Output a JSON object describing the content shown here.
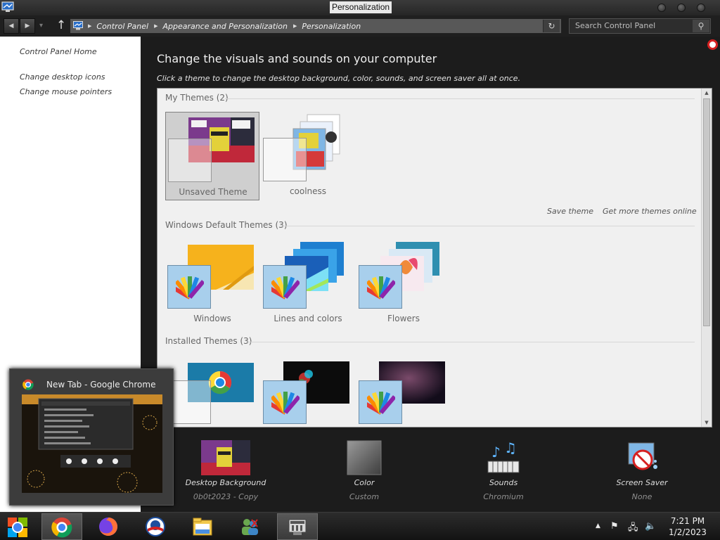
{
  "window": {
    "title": "Personalization"
  },
  "navigation": {
    "breadcrumb": [
      "Control Panel",
      "Appearance and Personalization",
      "Personalization"
    ],
    "search_placeholder": "Search Control Panel"
  },
  "sidebar": {
    "home_link": "Control Panel Home",
    "links": [
      "Change desktop icons",
      "Change mouse pointers"
    ]
  },
  "main": {
    "title": "Change the visuals and sounds on your computer",
    "subtitle": "Click a theme to change the desktop background, color, sounds, and screen saver all at once.",
    "sections": {
      "my_themes": "My Themes (2)",
      "windows_default": "Windows Default Themes (3)",
      "installed": "Installed Themes (3)"
    },
    "my_themes": [
      {
        "label": "Unsaved Theme",
        "selected": true
      },
      {
        "label": "coolness",
        "selected": false
      }
    ],
    "default_themes": [
      {
        "label": "Windows"
      },
      {
        "label": "Lines and colors"
      },
      {
        "label": "Flowers"
      }
    ],
    "save_theme_link": "Save theme",
    "get_more_link": "Get more themes online"
  },
  "bottom_bar": {
    "items": [
      {
        "label": "Desktop Background",
        "value": "0b0t2023 - Copy",
        "icon": "desktop-background-icon"
      },
      {
        "label": "Color",
        "value": "Custom",
        "icon": "color-icon"
      },
      {
        "label": "Sounds",
        "value": "Chromium",
        "icon": "sounds-icon"
      },
      {
        "label": "Screen Saver",
        "value": "None",
        "icon": "screen-saver-icon"
      }
    ]
  },
  "taskbar_preview": {
    "title": "New Tab - Google Chrome"
  },
  "taskbar": {
    "clock_time": "7:21 PM",
    "clock_date": "1/2/2023"
  },
  "colors": {
    "accent": "#a8cfec",
    "window_frame": "#1c1c1c",
    "theme_area": "#f0f0f0"
  }
}
